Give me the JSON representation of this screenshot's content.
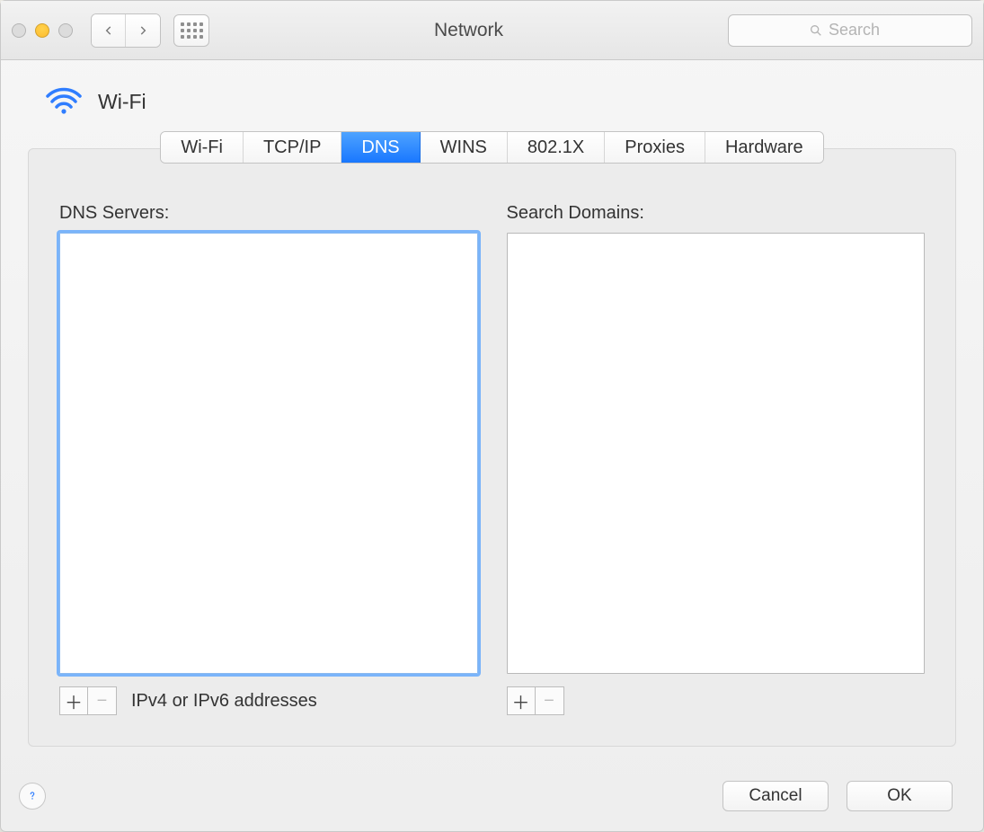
{
  "window": {
    "title": "Network"
  },
  "toolbar": {
    "search_placeholder": "Search"
  },
  "header": {
    "interface_name": "Wi-Fi"
  },
  "tabs": [
    {
      "label": "Wi-Fi",
      "active": false
    },
    {
      "label": "TCP/IP",
      "active": false
    },
    {
      "label": "DNS",
      "active": true
    },
    {
      "label": "WINS",
      "active": false
    },
    {
      "label": "802.1X",
      "active": false
    },
    {
      "label": "Proxies",
      "active": false
    },
    {
      "label": "Hardware",
      "active": false
    }
  ],
  "dns": {
    "servers_label": "DNS Servers:",
    "domains_label": "Search Domains:",
    "servers": [],
    "domains": [],
    "hint": "IPv4 or IPv6 addresses"
  },
  "buttons": {
    "cancel": "Cancel",
    "ok": "OK"
  },
  "colors": {
    "accent": "#2f7dff",
    "focus_ring": "#54a2ff"
  }
}
